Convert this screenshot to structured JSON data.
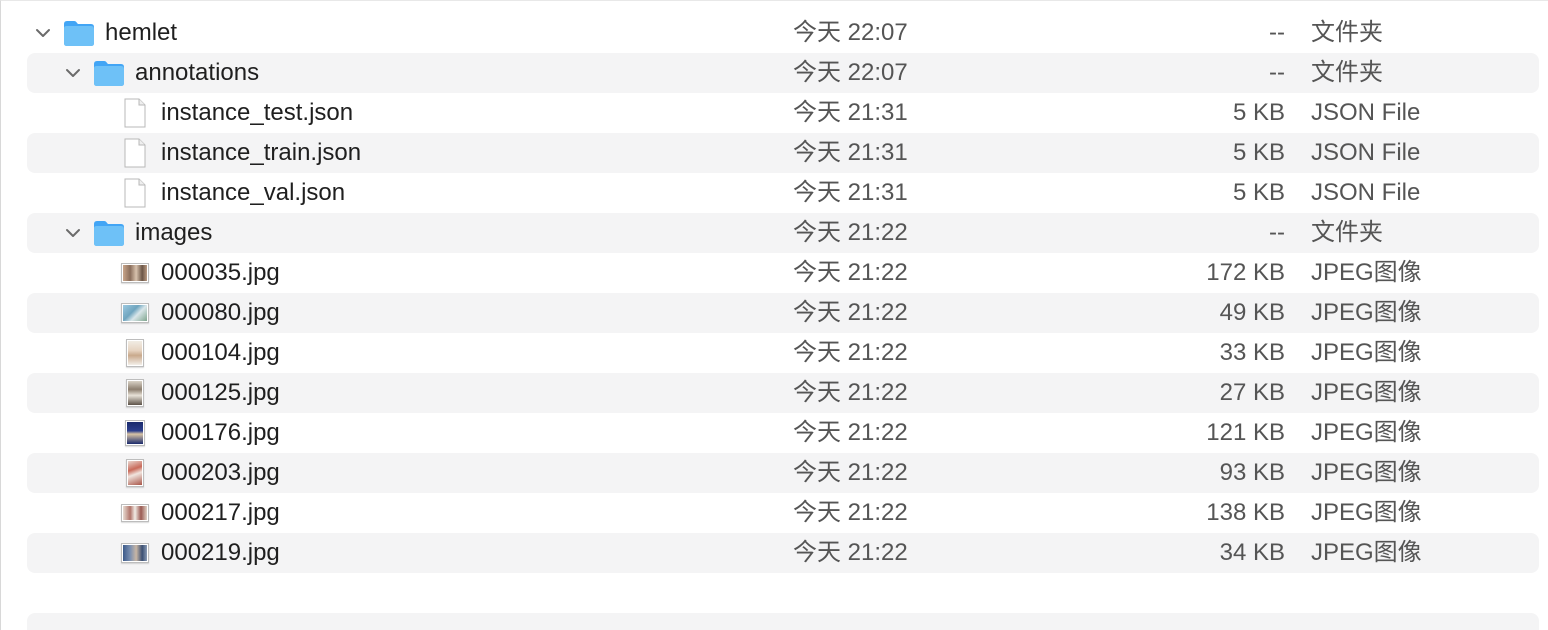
{
  "rows": [
    {
      "name": "hemlet",
      "date": "今天 22:07",
      "size": "--",
      "kind": "文件夹",
      "icon": "folder-icon",
      "expanded": true
    },
    {
      "name": "annotations",
      "date": "今天 22:07",
      "size": "--",
      "kind": "文件夹",
      "icon": "folder-icon",
      "expanded": true
    },
    {
      "name": "instance_test.json",
      "date": "今天 21:31",
      "size": "5 KB",
      "kind": "JSON File",
      "icon": "document-icon"
    },
    {
      "name": "instance_train.json",
      "date": "今天 21:31",
      "size": "5 KB",
      "kind": "JSON File",
      "icon": "document-icon"
    },
    {
      "name": "instance_val.json",
      "date": "今天 21:31",
      "size": "5 KB",
      "kind": "JSON File",
      "icon": "document-icon"
    },
    {
      "name": "images",
      "date": "今天 21:22",
      "size": "--",
      "kind": "文件夹",
      "icon": "folder-icon",
      "expanded": true
    },
    {
      "name": "000035.jpg",
      "date": "今天 21:22",
      "size": "172 KB",
      "kind": "JPEG图像",
      "icon": "image-thumbnail-icon"
    },
    {
      "name": "000080.jpg",
      "date": "今天 21:22",
      "size": "49 KB",
      "kind": "JPEG图像",
      "icon": "image-thumbnail-icon"
    },
    {
      "name": "000104.jpg",
      "date": "今天 21:22",
      "size": "33 KB",
      "kind": "JPEG图像",
      "icon": "image-thumbnail-icon"
    },
    {
      "name": "000125.jpg",
      "date": "今天 21:22",
      "size": "27 KB",
      "kind": "JPEG图像",
      "icon": "image-thumbnail-icon"
    },
    {
      "name": "000176.jpg",
      "date": "今天 21:22",
      "size": "121 KB",
      "kind": "JPEG图像",
      "icon": "image-thumbnail-icon"
    },
    {
      "name": "000203.jpg",
      "date": "今天 21:22",
      "size": "93 KB",
      "kind": "JPEG图像",
      "icon": "image-thumbnail-icon"
    },
    {
      "name": "000217.jpg",
      "date": "今天 21:22",
      "size": "138 KB",
      "kind": "JPEG图像",
      "icon": "image-thumbnail-icon"
    },
    {
      "name": "000219.jpg",
      "date": "今天 21:22",
      "size": "34 KB",
      "kind": "JPEG图像",
      "icon": "image-thumbnail-icon"
    }
  ],
  "colors": {
    "folder_blue": "#64b5f6",
    "folder_tab": "#42a5f5",
    "row_alt": "#f4f4f5",
    "secondary_text": "#555555"
  }
}
